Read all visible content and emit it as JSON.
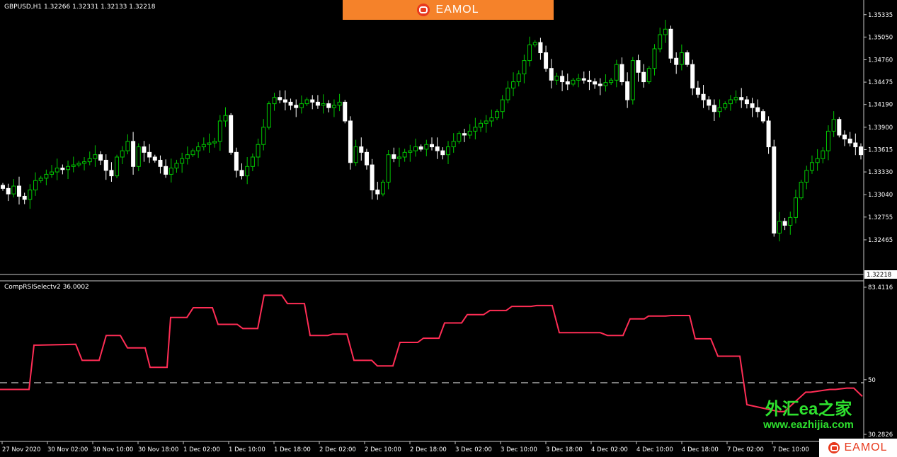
{
  "header": {
    "symbol_info": "GBPUSD,H1  1.32266 1.32331 1.32133 1.32218",
    "indicator_info": "CompRSISelectv2 36.0002"
  },
  "banner": {
    "brand": "EAMOL"
  },
  "watermark": {
    "cn": "外汇ea之家",
    "url": "www.eazhijia.com"
  },
  "badge": {
    "brand": "EAMOL"
  },
  "colors": {
    "background": "#000000",
    "bull_candle": "#00c800",
    "bear_candle": "#ffffff",
    "rsi_line": "#ff2d55",
    "banner": "#f5822a"
  },
  "chart_data": [
    {
      "type": "candlestick",
      "ylim": [
        1.3205,
        1.3545
      ],
      "y_ticks": [
        "1.35335",
        "1.35050",
        "1.34760",
        "1.34475",
        "1.34190",
        "1.33900",
        "1.33615",
        "1.33330",
        "1.33040",
        "1.32755",
        "1.32465"
      ],
      "current_price": "1.32218",
      "close_series": [
        1.3312,
        1.3305,
        1.3315,
        1.3302,
        1.3298,
        1.331,
        1.3322,
        1.3325,
        1.333,
        1.3333,
        1.3338,
        1.3336,
        1.334,
        1.3342,
        1.3344,
        1.3346,
        1.335,
        1.3355,
        1.3348,
        1.3335,
        1.3328,
        1.3352,
        1.336,
        1.3372,
        1.334,
        1.3365,
        1.3358,
        1.3352,
        1.3348,
        1.334,
        1.333,
        1.3338,
        1.3344,
        1.335,
        1.3355,
        1.336,
        1.3365,
        1.3368,
        1.337,
        1.3372,
        1.3398,
        1.3405,
        1.3358,
        1.3335,
        1.3328,
        1.334,
        1.3352,
        1.3368,
        1.339,
        1.342,
        1.3428,
        1.3425,
        1.3422,
        1.3418,
        1.3415,
        1.342,
        1.3425,
        1.3422,
        1.3418,
        1.342,
        1.3415,
        1.3418,
        1.3422,
        1.3398,
        1.3345,
        1.3365,
        1.3358,
        1.3342,
        1.331,
        1.3305,
        1.332,
        1.3355,
        1.335,
        1.3352,
        1.3358,
        1.336,
        1.3365,
        1.3362,
        1.3368,
        1.3365,
        1.336,
        1.3355,
        1.3365,
        1.3372,
        1.3382,
        1.338,
        1.3385,
        1.339,
        1.3395,
        1.3398,
        1.3402,
        1.341,
        1.3425,
        1.344,
        1.3448,
        1.3458,
        1.3475,
        1.3495,
        1.3498,
        1.3485,
        1.3465,
        1.345,
        1.3455,
        1.3448,
        1.3445,
        1.345,
        1.3452,
        1.345,
        1.3448,
        1.3445,
        1.3443,
        1.3447,
        1.345,
        1.347,
        1.3448,
        1.3425,
        1.3475,
        1.346,
        1.3448,
        1.3465,
        1.349,
        1.3508,
        1.3515,
        1.3478,
        1.347,
        1.3485,
        1.347,
        1.344,
        1.3432,
        1.3425,
        1.3418,
        1.341,
        1.3415,
        1.342,
        1.3425,
        1.3428,
        1.3425,
        1.342,
        1.3415,
        1.341,
        1.3398,
        1.3365,
        1.3255,
        1.327,
        1.3265,
        1.3275,
        1.33,
        1.332,
        1.3335,
        1.3345,
        1.335,
        1.336,
        1.3385,
        1.34,
        1.338,
        1.3375,
        1.337,
        1.3365,
        1.3355
      ]
    },
    {
      "type": "line",
      "ylim": [
        30.2826,
        83.4116
      ],
      "y_ticks": [
        "83.4116",
        "50",
        "30.2826"
      ],
      "level_line": 50,
      "x_ticks": [
        "27 Nov 2020",
        "30 Nov 02:00",
        "30 Nov 10:00",
        "30 Nov 18:00",
        "1 Dec 02:00",
        "1 Dec 10:00",
        "1 Dec 18:00",
        "2 Dec 02:00",
        "2 Dec 10:00",
        "2 Dec 18:00",
        "3 Dec 02:00",
        "3 Dec 10:00",
        "3 Dec 18:00",
        "4 Dec 02:00",
        "4 Dec 10:00",
        "4 Dec 18:00",
        "7 Dec 02:00",
        "7 Dec 10:00"
      ],
      "x": [
        0,
        36,
        41,
        48,
        54,
        107,
        116,
        140,
        150,
        170,
        180,
        205,
        212,
        236,
        241,
        264,
        273,
        300,
        308,
        335,
        343,
        364,
        373,
        398,
        406,
        430,
        438,
        463,
        470,
        490,
        500,
        525,
        533,
        555,
        565,
        590,
        598,
        620,
        628,
        652,
        660,
        683,
        692,
        715,
        723,
        750,
        758,
        780,
        790,
        820,
        828,
        848,
        858,
        880,
        890,
        910,
        916,
        940,
        948,
        974,
        982,
        1004,
        1014,
        1045,
        1055,
        1100,
        1108,
        1138,
        1145,
        1172,
        1180,
        1196,
        1206,
        1218
      ],
      "y": [
        46.5,
        46.5,
        46.5,
        62.5,
        62.5,
        62.8,
        57.0,
        57.0,
        66.0,
        66.0,
        61.5,
        61.5,
        54.5,
        54.5,
        72.5,
        72.5,
        76.0,
        76.0,
        70.0,
        70.0,
        68.5,
        68.5,
        80.5,
        80.5,
        77.5,
        77.5,
        66.0,
        66.0,
        66.5,
        66.5,
        57.0,
        57.0,
        55.0,
        55.0,
        63.5,
        63.5,
        65.0,
        65.0,
        70.5,
        70.5,
        73.5,
        73.5,
        75.0,
        75.0,
        76.5,
        76.5,
        76.8,
        76.8,
        67.0,
        67.0,
        67.0,
        67.0,
        66.0,
        66.0,
        72.0,
        72.0,
        73.0,
        73.0,
        73.2,
        73.2,
        64.8,
        64.8,
        58.5,
        58.5,
        41.0,
        38.5,
        38.5,
        45.5,
        45.5,
        46.5,
        46.5,
        47.0,
        47.0,
        44.0
      ]
    }
  ]
}
